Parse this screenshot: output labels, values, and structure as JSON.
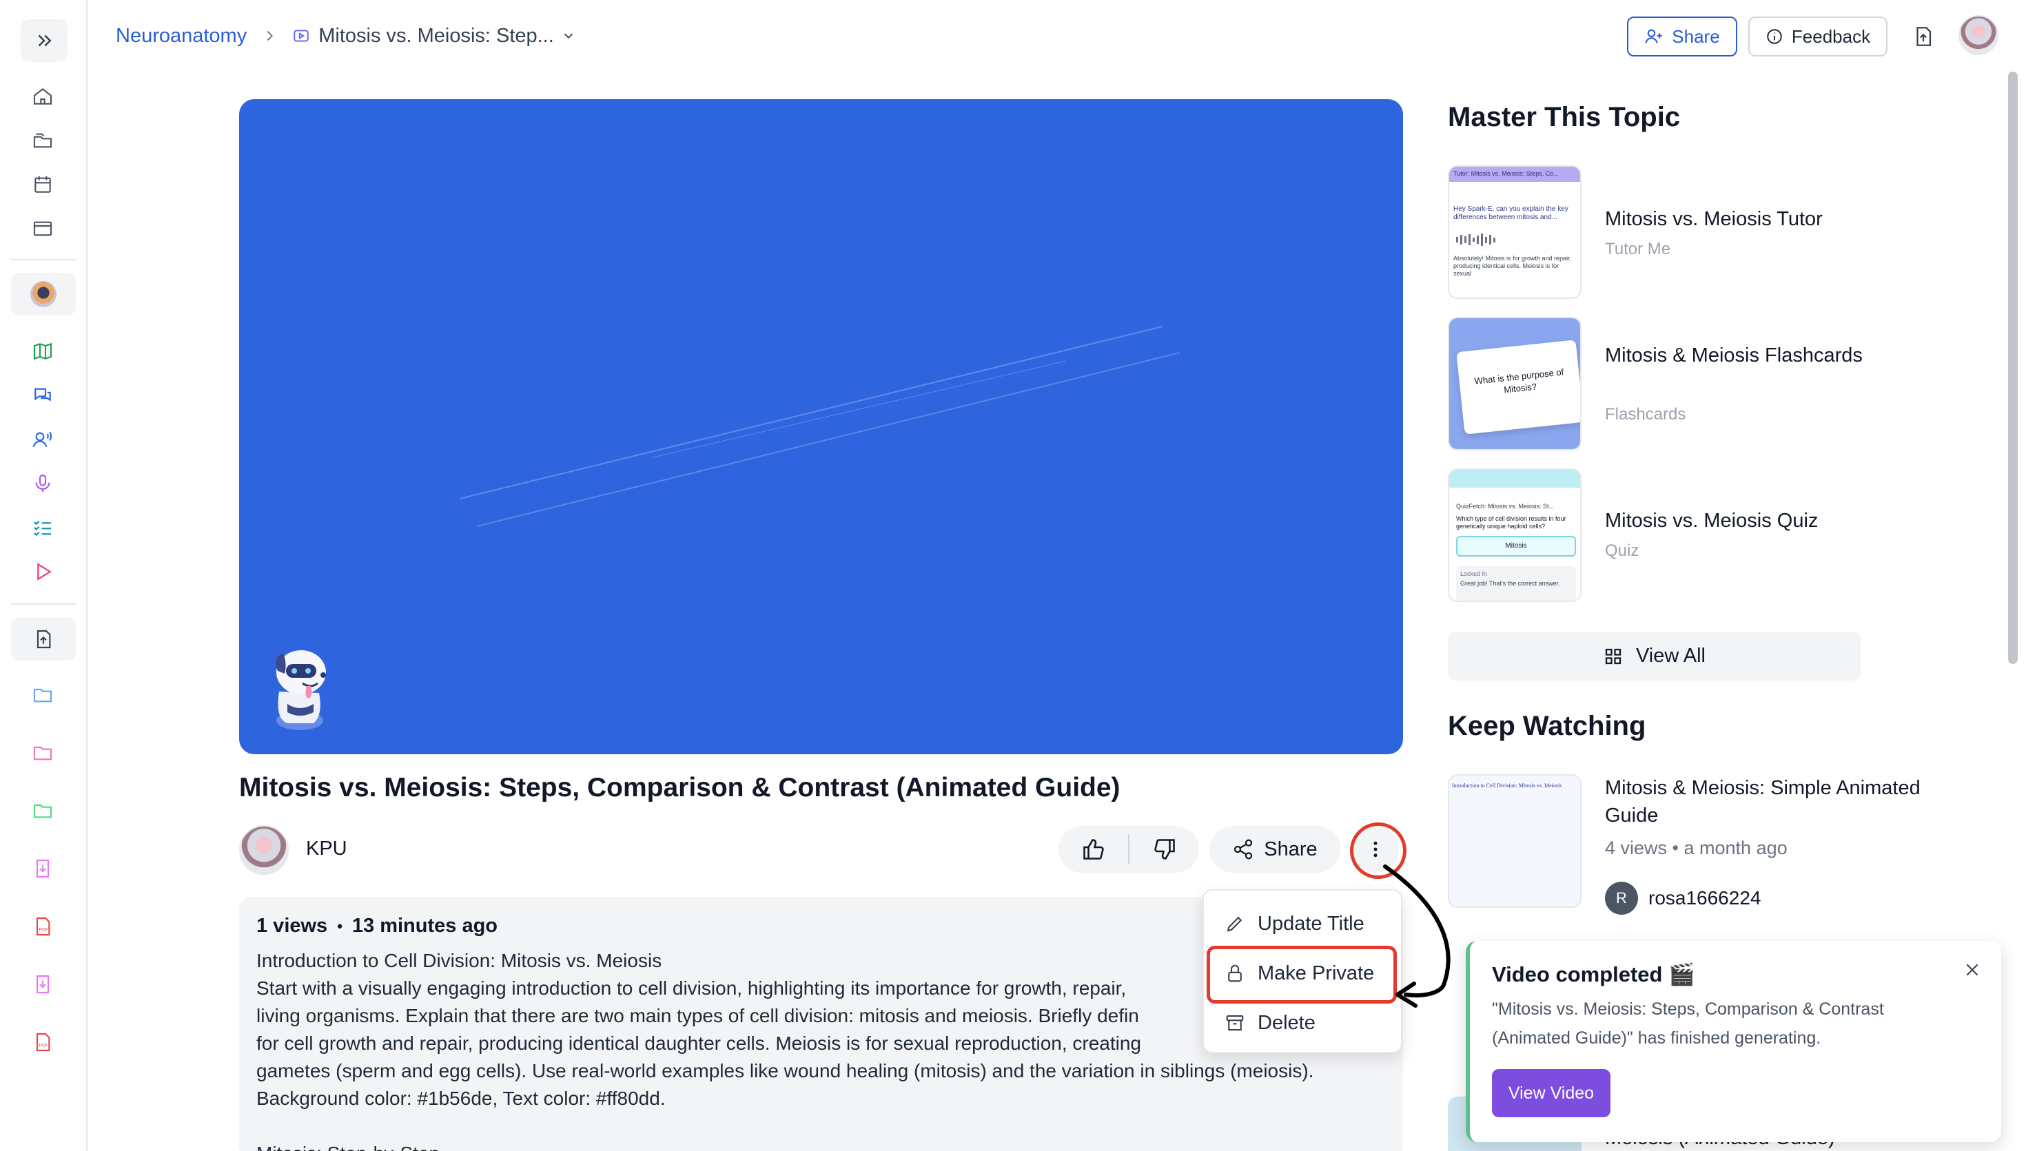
{
  "breadcrumb": {
    "root": "Neuroanatomy",
    "current": "Mitosis vs. Meiosis: Step..."
  },
  "header": {
    "share_label": "Share",
    "feedback_label": "Feedback"
  },
  "video": {
    "title": "Mitosis vs. Meiosis: Steps, Comparison & Contrast (Animated Guide)",
    "background_color": "#2f64df",
    "channel": "KPU",
    "share_label": "Share",
    "views": "1 views",
    "age": "13 minutes ago",
    "description": "Introduction to Cell Division: Mitosis vs. Meiosis\nStart with a visually engaging introduction to cell division, highlighting its importance for growth, repair,\nliving organisms. Explain that there are two main types of cell division: mitosis and meiosis. Briefly defin\nfor cell growth and repair, producing identical daughter cells. Meiosis is for sexual reproduction, creating\ngametes (sperm and egg cells). Use real-world examples like wound healing (mitosis) and the variation in siblings (meiosis).\nBackground color: #1b56de, Text color: #ff80dd.\n\nMitosis: Step-by-Step"
  },
  "menu": {
    "items": [
      {
        "label": "Update Title",
        "icon": "pencil-icon"
      },
      {
        "label": "Make Private",
        "icon": "lock-icon"
      },
      {
        "label": "Delete",
        "icon": "archive-icon"
      }
    ],
    "highlight_color": "#e33a2c"
  },
  "master": {
    "title": "Master This Topic",
    "cards": [
      {
        "title": "Mitosis vs. Meiosis Tutor",
        "sub": "Tutor Me"
      },
      {
        "title": "Mitosis & Meiosis Flashcards",
        "sub": "Flashcards"
      },
      {
        "title": "Mitosis vs. Meiosis Quiz",
        "sub": "Quiz"
      }
    ],
    "view_all": "View All"
  },
  "thumb_text": {
    "tutor_header": "Tutor: Mitosis vs. Meiosis: Steps, Co...",
    "tutor_q": "Hey Spark-E, can you explain the key differences between mitosis and...",
    "tutor_a": "Absolutely! Mitosis is for growth and repair, producing identical cells. Meiosis is for sexual",
    "flash_q": "What is the purpose of Mitosis?",
    "quiz_header": "QuizFetch: Mitosis vs. Meiosis: St...",
    "quiz_q": "Which type of cell division results in four genetically unique haploid cells?",
    "quiz_opt": "Mitosis",
    "quiz_locked": "Locked In",
    "quiz_fb": "Great job! That's the correct answer.",
    "kw_thumb": "Introduction to Cell Division: Mitosis vs. Meiosis"
  },
  "keep_watching": {
    "title": "Keep Watching",
    "cards": [
      {
        "title": "Mitosis & Meiosis: Simple Animated Guide",
        "views": "4 views",
        "age": "a month ago",
        "user": "rosa1666224",
        "initial": "R"
      },
      {
        "title": "Meiosis (Animated Guide)"
      }
    ]
  },
  "toast": {
    "title": "Video completed 🎬",
    "message": "\"Mitosis vs. Meiosis: Steps, Comparison & Contrast (Animated Guide)\" has finished generating.",
    "button": "View Video",
    "accent": "#7c4ddf"
  }
}
